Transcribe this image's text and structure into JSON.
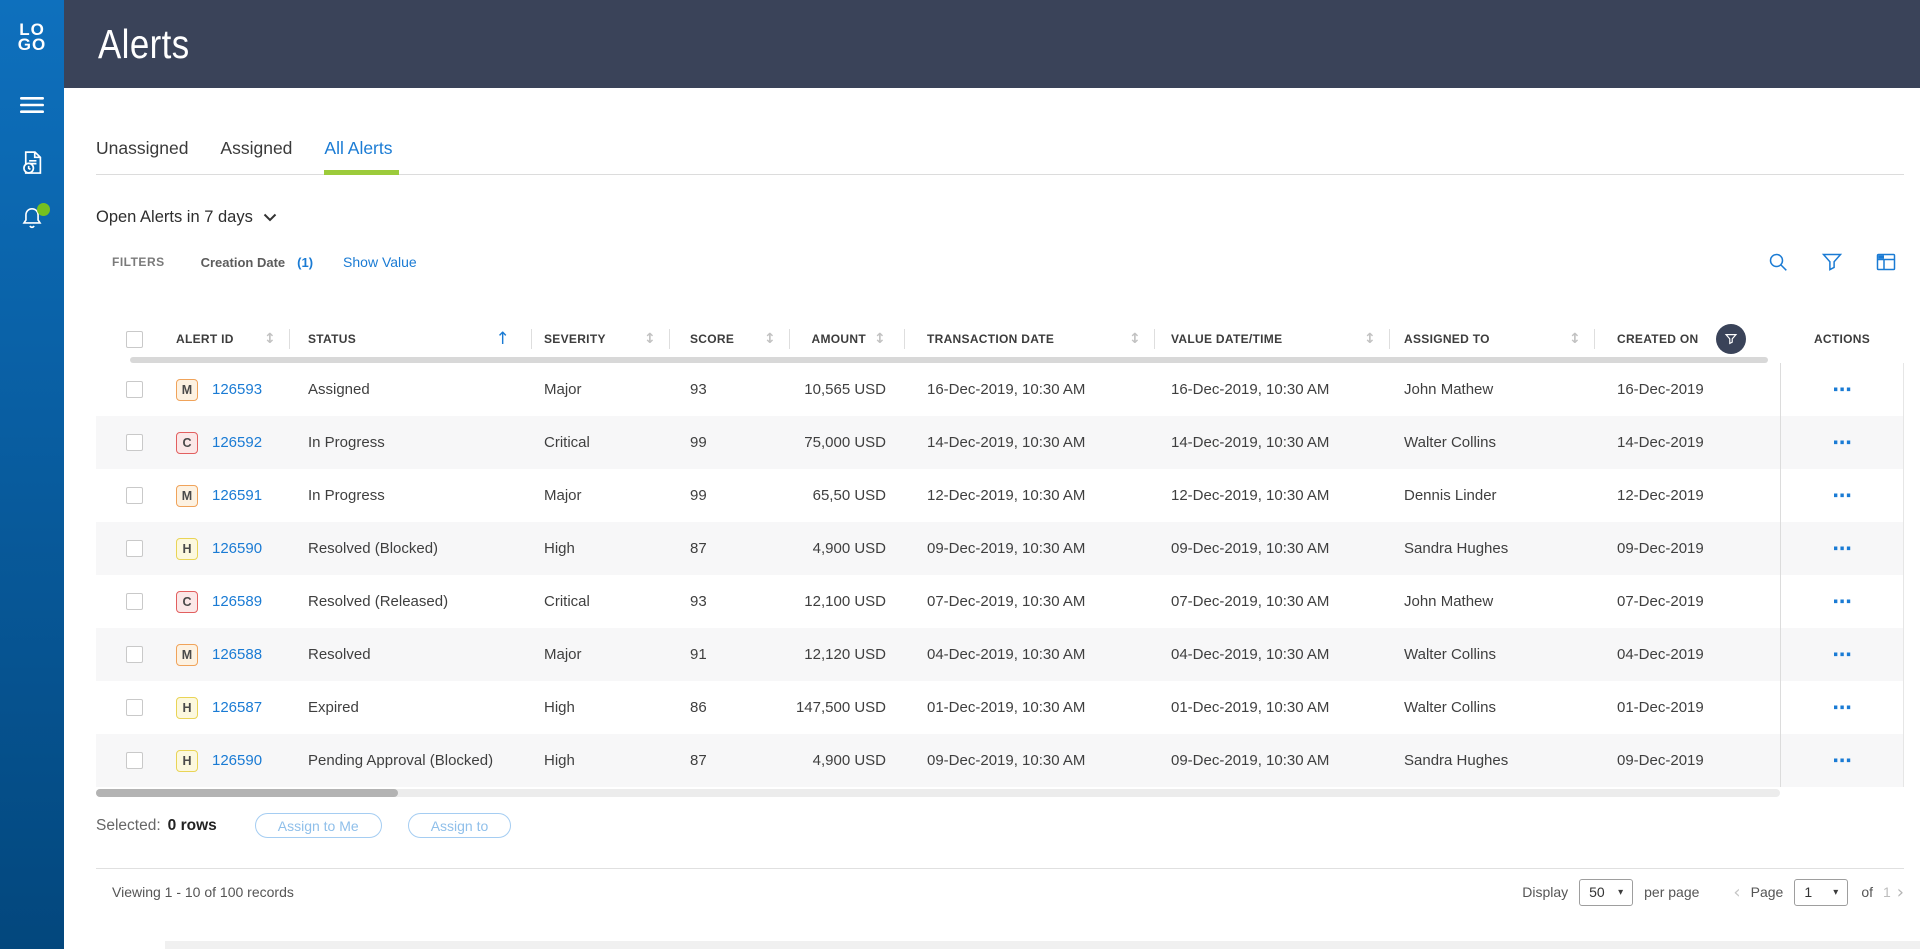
{
  "sidebar": {
    "logo_line1": "LO",
    "logo_line2": "GO",
    "notification_dot_color": "#76c021"
  },
  "header": {
    "title": "Alerts"
  },
  "tabs": [
    {
      "label": "Unassigned",
      "active": false
    },
    {
      "label": "Assigned",
      "active": false
    },
    {
      "label": "All Alerts",
      "active": true
    }
  ],
  "filter_dropdown": {
    "label": "Open Alerts in 7 days"
  },
  "filters_bar": {
    "filters_label": "FILTERS",
    "filter_name": "Creation Date",
    "filter_count": "(1)",
    "show_value": "Show Value"
  },
  "table": {
    "columns": [
      {
        "label": "",
        "type": "checkbox"
      },
      {
        "label": "ALERT ID",
        "sort": "none"
      },
      {
        "label": "STATUS",
        "sort": "asc"
      },
      {
        "label": "SEVERITY",
        "sort": "none"
      },
      {
        "label": "SCORE",
        "sort": "none"
      },
      {
        "label": "AMOUNT",
        "sort": "none"
      },
      {
        "label": "TRANSACTION DATE",
        "sort": "none"
      },
      {
        "label": "VALUE DATE/TIME",
        "sort": "none"
      },
      {
        "label": "ASSIGNED TO",
        "sort": "none"
      },
      {
        "label": "CREATED ON",
        "filtered": true
      },
      {
        "label": "ACTIONS"
      }
    ],
    "rows": [
      {
        "severity_code": "M",
        "alert_id": "126593",
        "status": "Assigned",
        "severity": "Major",
        "score": "93",
        "amount": "10,565 USD",
        "transaction_date": "16-Dec-2019, 10:30 AM",
        "value_date": "16-Dec-2019, 10:30 AM",
        "assigned_to": "John Mathew",
        "created_on": "16-Dec-2019"
      },
      {
        "severity_code": "C",
        "alert_id": "126592",
        "status": "In Progress",
        "severity": "Critical",
        "score": "99",
        "amount": "75,000 USD",
        "transaction_date": "14-Dec-2019, 10:30 AM",
        "value_date": "14-Dec-2019, 10:30 AM",
        "assigned_to": "Walter Collins",
        "created_on": "14-Dec-2019"
      },
      {
        "severity_code": "M",
        "alert_id": "126591",
        "status": "In Progress",
        "severity": "Major",
        "score": "99",
        "amount": "65,50 USD",
        "transaction_date": "12-Dec-2019, 10:30 AM",
        "value_date": "12-Dec-2019, 10:30 AM",
        "assigned_to": "Dennis Linder",
        "created_on": "12-Dec-2019"
      },
      {
        "severity_code": "H",
        "alert_id": "126590",
        "status": "Resolved (Blocked)",
        "severity": "High",
        "score": "87",
        "amount": "4,900 USD",
        "transaction_date": "09-Dec-2019, 10:30 AM",
        "value_date": "09-Dec-2019, 10:30 AM",
        "assigned_to": "Sandra Hughes",
        "created_on": "09-Dec-2019"
      },
      {
        "severity_code": "C",
        "alert_id": "126589",
        "status": "Resolved (Released)",
        "severity": "Critical",
        "score": "93",
        "amount": "12,100 USD",
        "transaction_date": "07-Dec-2019, 10:30 AM",
        "value_date": "07-Dec-2019, 10:30 AM",
        "assigned_to": "John Mathew",
        "created_on": "07-Dec-2019"
      },
      {
        "severity_code": "M",
        "alert_id": "126588",
        "status": "Resolved",
        "severity": "Major",
        "score": "91",
        "amount": "12,120 USD",
        "transaction_date": "04-Dec-2019, 10:30 AM",
        "value_date": "04-Dec-2019, 10:30 AM",
        "assigned_to": "Walter Collins",
        "created_on": "04-Dec-2019"
      },
      {
        "severity_code": "H",
        "alert_id": "126587",
        "status": "Expired",
        "severity": "High",
        "score": "86",
        "amount": "147,500 USD",
        "transaction_date": "01-Dec-2019, 10:30 AM",
        "value_date": "01-Dec-2019, 10:30 AM",
        "assigned_to": "Walter Collins",
        "created_on": "01-Dec-2019"
      },
      {
        "severity_code": "H",
        "alert_id": "126590",
        "status": "Pending Approval (Blocked)",
        "severity": "High",
        "score": "87",
        "amount": "4,900 USD",
        "transaction_date": "09-Dec-2019, 10:30 AM",
        "value_date": "09-Dec-2019, 10:30 AM",
        "assigned_to": "Sandra Hughes",
        "created_on": "09-Dec-2019"
      }
    ]
  },
  "severity_badges": {
    "M": {
      "bg": "#fdf2e2",
      "border": "#f0a35a"
    },
    "C": {
      "bg": "#fbe8e8",
      "border": "#e25f5f"
    },
    "H": {
      "bg": "#fcf8de",
      "border": "#e9d456"
    }
  },
  "selection": {
    "label": "Selected:",
    "count": "0 rows",
    "assign_to_me_label": "Assign to Me",
    "assign_to_label": "Assign to"
  },
  "pagination": {
    "viewing": "Viewing 1 - 10 of 100 records",
    "display_label": "Display",
    "page_size": "50",
    "per_page_label": "per page",
    "page_label": "Page",
    "page_value": "1",
    "of_label": "of",
    "total_pages": "1"
  },
  "colors": {
    "accent_blue": "#1a7bd4",
    "tab_underline_green": "#9ccb3b",
    "header_navy": "#3a4359",
    "sidebar_blue_top": "#0e70bd",
    "sidebar_blue_bottom": "#03477d"
  }
}
